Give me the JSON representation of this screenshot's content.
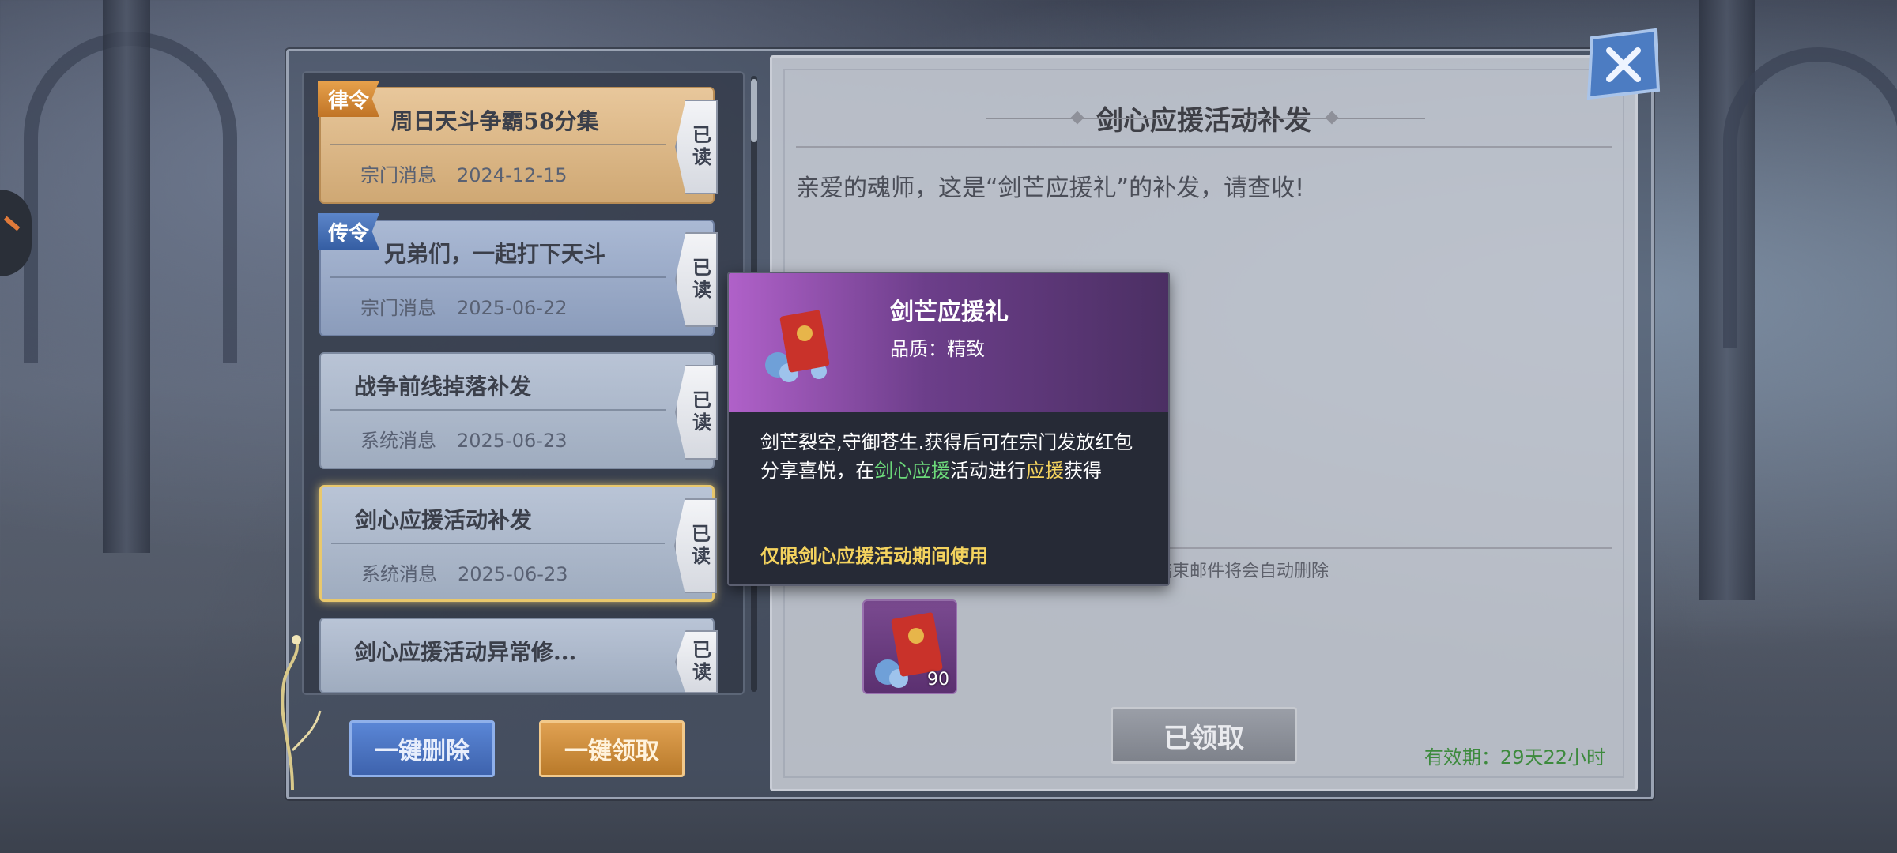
{
  "mail_list": [
    {
      "ribbon": "律令",
      "title": "周日天斗争霸58分集",
      "category": "宗门消息",
      "date": "2024-12-15",
      "read": "已读"
    },
    {
      "ribbon": "传令",
      "title": "兄弟们，一起打下天斗",
      "category": "宗门消息",
      "date": "2025-06-22",
      "read": "已读"
    },
    {
      "title": "战争前线掉落补发",
      "category": "系统消息",
      "date": "2025-06-23",
      "read": "已读"
    },
    {
      "title": "剑心应援活动补发",
      "category": "系统消息",
      "date": "2025-06-23",
      "read": "已读"
    },
    {
      "title": "剑心应援活动异常修...",
      "read": "已读"
    }
  ],
  "buttons": {
    "delete_all": "一键删除",
    "claim_all": "一键领取"
  },
  "detail": {
    "title": "剑心应援活动补发",
    "body": "亲爱的魂师，这是“剑芒应援礼”的补发，请查收!",
    "attachment_note": "结束邮件将会自动删除",
    "reward_count": "90",
    "claimed_button": "已领取",
    "expiry": "有效期：29天22小时"
  },
  "tooltip": {
    "name": "剑芒应援礼",
    "quality": "品质：精致",
    "desc_part1": "剑芒裂空,守御苍生.获得后可在宗门发放红包分享喜悦，在",
    "desc_green": "剑心应援",
    "desc_part2": "活动进行",
    "desc_yellow": "应援",
    "desc_part3": "获得",
    "note": "仅限剑心应援活动期间使用"
  },
  "colors": {
    "accent_gold": "#e9c86c",
    "tooltip_purple": "#b061c9",
    "expiry_green": "#3d8a3d",
    "highlight_green": "#6cd97a",
    "highlight_yellow": "#f4d35e"
  }
}
